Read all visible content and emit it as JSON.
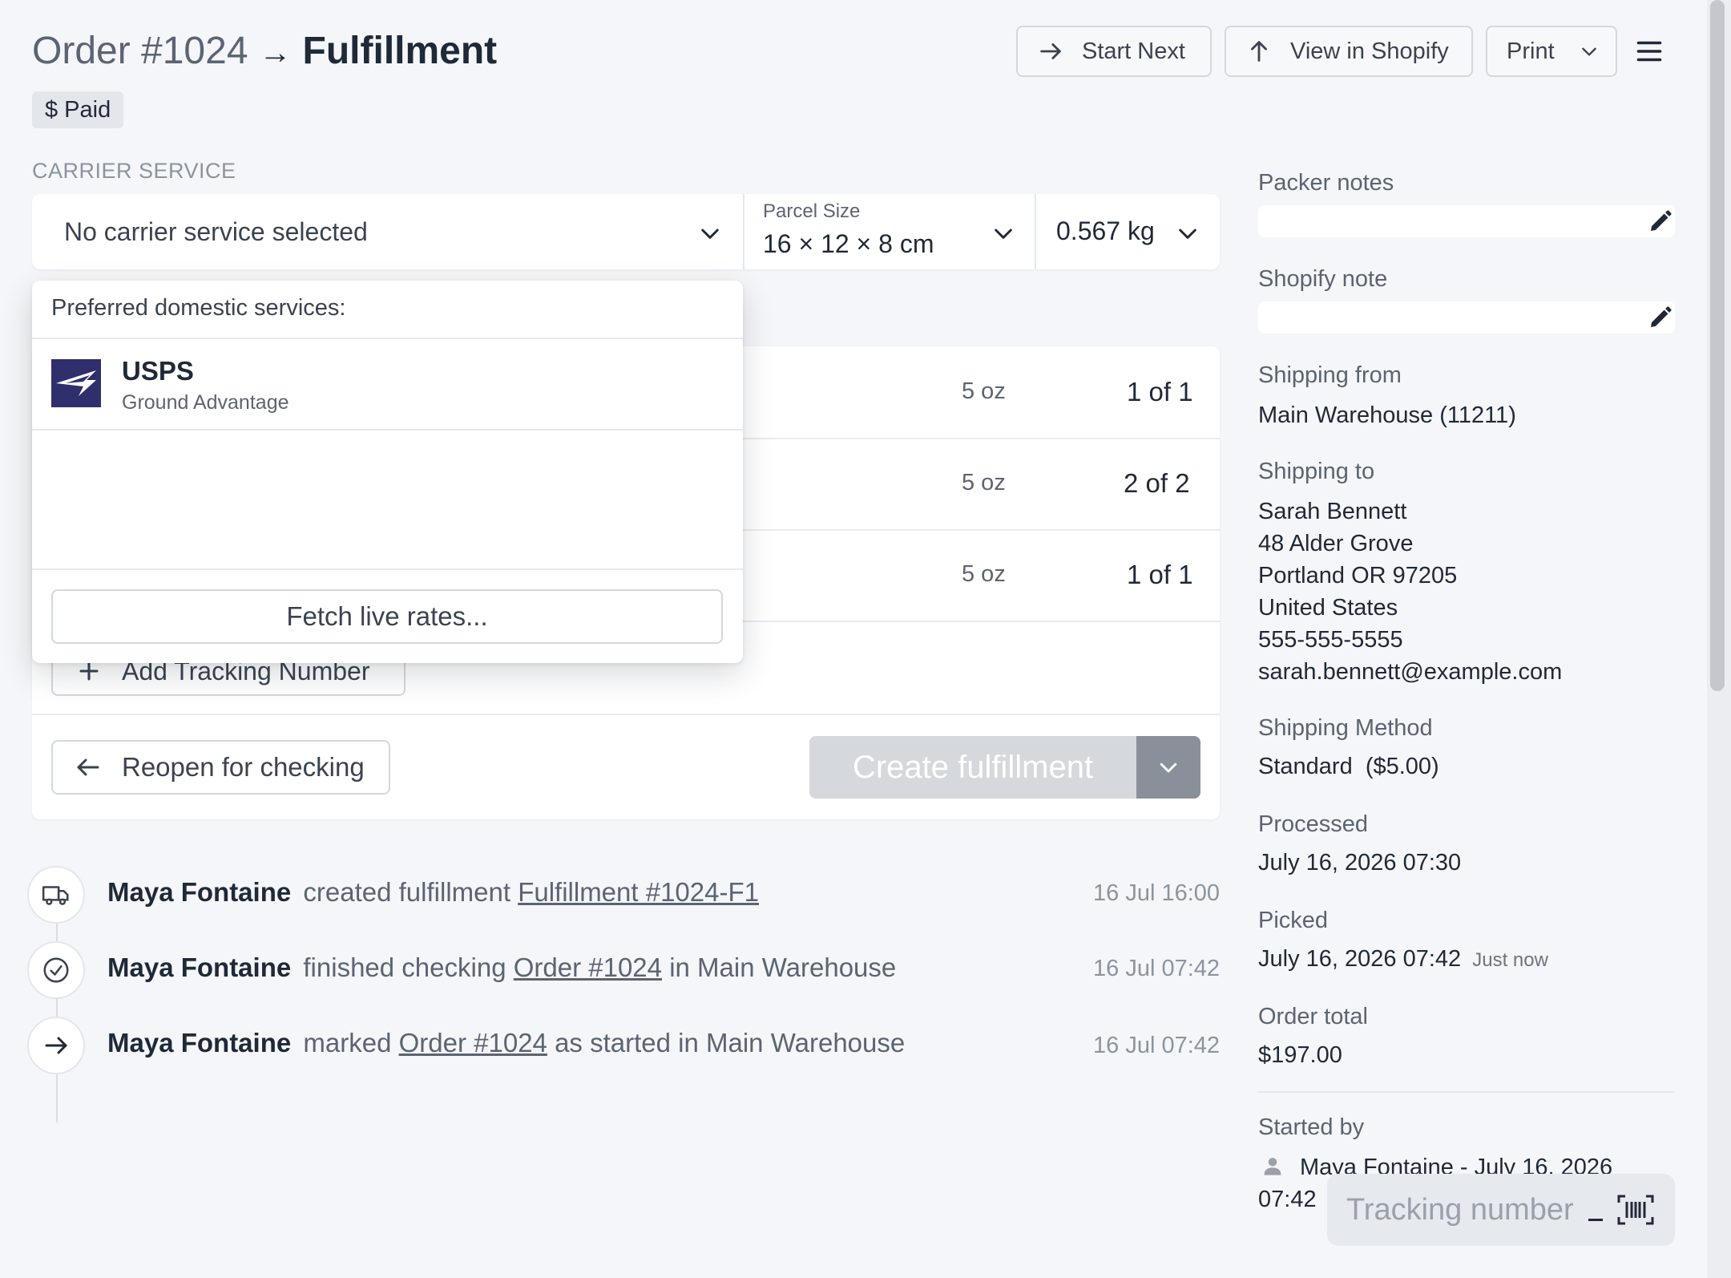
{
  "header": {
    "order_label": "Order #1024",
    "arrow": "→",
    "page_label": "Fulfillment",
    "paid_badge": "$ Paid",
    "start_next": "Start Next",
    "view_in_shopify": "View in Shopify",
    "print": "Print"
  },
  "carrier": {
    "section_label": "CARRIER SERVICE",
    "selected_service": "No carrier service selected",
    "parcel_size_label": "Parcel Size",
    "parcel_size_value": "16 × 12 × 8 cm",
    "weight_value": "0.567 kg"
  },
  "dropdown": {
    "heading": "Preferred domestic services:",
    "services": [
      {
        "name": "USPS",
        "service": "Ground Advantage",
        "logo_icon": "usps-eagle-icon"
      }
    ],
    "fetch_button": "Fetch live rates..."
  },
  "items": [
    {
      "weight": "5 oz",
      "qty": "1 of 1"
    },
    {
      "weight": "5 oz",
      "qty": "2 of 2"
    },
    {
      "weight": "5 oz",
      "qty": "1 of 1"
    }
  ],
  "actions": {
    "add_tracking": "Add Tracking Number",
    "reopen": "Reopen for checking",
    "create_fulfillment": "Create fulfillment"
  },
  "activity": [
    {
      "icon": "truck-icon",
      "user": "Maya Fontaine",
      "action": "created fulfillment",
      "link": "Fulfillment #1024-F1",
      "suffix": "",
      "time": "16 Jul 16:00"
    },
    {
      "icon": "check-circle-icon",
      "user": "Maya Fontaine",
      "action": "finished checking",
      "link": "Order #1024",
      "suffix": "in Main Warehouse",
      "time": "16 Jul 07:42"
    },
    {
      "icon": "arrow-right-icon",
      "user": "Maya Fontaine",
      "action": "marked",
      "link": "Order #1024",
      "suffix": "as started in Main Warehouse",
      "time": "16 Jul 07:42"
    }
  ],
  "sidebar": {
    "packer_notes_label": "Packer notes",
    "shopify_note_label": "Shopify note",
    "shipping_from_label": "Shipping from",
    "shipping_from": "Main Warehouse (11211)",
    "shipping_to_label": "Shipping to",
    "shipping_to": [
      "Sarah Bennett",
      "48 Alder Grove",
      "Portland OR 97205",
      "United States",
      "555-555-5555",
      "sarah.bennett@example.com"
    ],
    "shipping_method_label": "Shipping Method",
    "shipping_method": "Standard  ($5.00)",
    "processed_label": "Processed",
    "processed": "July 16, 2026 07:30",
    "picked_label": "Picked",
    "picked": "July 16, 2026 07:42",
    "picked_relative": "Just now",
    "order_total_label": "Order total",
    "order_total": "$197.00",
    "started_by_label": "Started by",
    "started_by": "Maya Fontaine - July 16, 2026",
    "started_by_time": "07:42"
  },
  "tracking_input": {
    "placeholder": "Tracking number"
  },
  "colors": {
    "background": "#f4f6f9",
    "card": "#ffffff",
    "text_primary": "#1f2937",
    "text_muted": "#5b6472",
    "usps_blue": "#2f2f6e",
    "create_disabled": "#d5d8dc",
    "split_button": "#8a9099"
  }
}
